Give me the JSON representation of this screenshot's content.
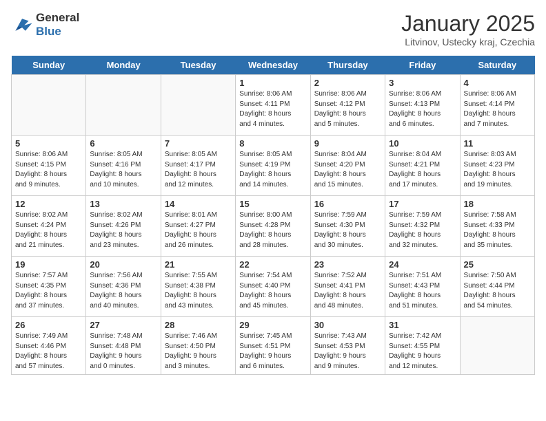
{
  "header": {
    "logo_line1": "General",
    "logo_line2": "Blue",
    "title": "January 2025",
    "subtitle": "Litvinov, Ustecky kraj, Czechia"
  },
  "weekdays": [
    "Sunday",
    "Monday",
    "Tuesday",
    "Wednesday",
    "Thursday",
    "Friday",
    "Saturday"
  ],
  "weeks": [
    [
      {
        "num": "",
        "info": ""
      },
      {
        "num": "",
        "info": ""
      },
      {
        "num": "",
        "info": ""
      },
      {
        "num": "1",
        "info": "Sunrise: 8:06 AM\nSunset: 4:11 PM\nDaylight: 8 hours\nand 4 minutes."
      },
      {
        "num": "2",
        "info": "Sunrise: 8:06 AM\nSunset: 4:12 PM\nDaylight: 8 hours\nand 5 minutes."
      },
      {
        "num": "3",
        "info": "Sunrise: 8:06 AM\nSunset: 4:13 PM\nDaylight: 8 hours\nand 6 minutes."
      },
      {
        "num": "4",
        "info": "Sunrise: 8:06 AM\nSunset: 4:14 PM\nDaylight: 8 hours\nand 7 minutes."
      }
    ],
    [
      {
        "num": "5",
        "info": "Sunrise: 8:06 AM\nSunset: 4:15 PM\nDaylight: 8 hours\nand 9 minutes."
      },
      {
        "num": "6",
        "info": "Sunrise: 8:05 AM\nSunset: 4:16 PM\nDaylight: 8 hours\nand 10 minutes."
      },
      {
        "num": "7",
        "info": "Sunrise: 8:05 AM\nSunset: 4:17 PM\nDaylight: 8 hours\nand 12 minutes."
      },
      {
        "num": "8",
        "info": "Sunrise: 8:05 AM\nSunset: 4:19 PM\nDaylight: 8 hours\nand 14 minutes."
      },
      {
        "num": "9",
        "info": "Sunrise: 8:04 AM\nSunset: 4:20 PM\nDaylight: 8 hours\nand 15 minutes."
      },
      {
        "num": "10",
        "info": "Sunrise: 8:04 AM\nSunset: 4:21 PM\nDaylight: 8 hours\nand 17 minutes."
      },
      {
        "num": "11",
        "info": "Sunrise: 8:03 AM\nSunset: 4:23 PM\nDaylight: 8 hours\nand 19 minutes."
      }
    ],
    [
      {
        "num": "12",
        "info": "Sunrise: 8:02 AM\nSunset: 4:24 PM\nDaylight: 8 hours\nand 21 minutes."
      },
      {
        "num": "13",
        "info": "Sunrise: 8:02 AM\nSunset: 4:26 PM\nDaylight: 8 hours\nand 23 minutes."
      },
      {
        "num": "14",
        "info": "Sunrise: 8:01 AM\nSunset: 4:27 PM\nDaylight: 8 hours\nand 26 minutes."
      },
      {
        "num": "15",
        "info": "Sunrise: 8:00 AM\nSunset: 4:28 PM\nDaylight: 8 hours\nand 28 minutes."
      },
      {
        "num": "16",
        "info": "Sunrise: 7:59 AM\nSunset: 4:30 PM\nDaylight: 8 hours\nand 30 minutes."
      },
      {
        "num": "17",
        "info": "Sunrise: 7:59 AM\nSunset: 4:32 PM\nDaylight: 8 hours\nand 32 minutes."
      },
      {
        "num": "18",
        "info": "Sunrise: 7:58 AM\nSunset: 4:33 PM\nDaylight: 8 hours\nand 35 minutes."
      }
    ],
    [
      {
        "num": "19",
        "info": "Sunrise: 7:57 AM\nSunset: 4:35 PM\nDaylight: 8 hours\nand 37 minutes."
      },
      {
        "num": "20",
        "info": "Sunrise: 7:56 AM\nSunset: 4:36 PM\nDaylight: 8 hours\nand 40 minutes."
      },
      {
        "num": "21",
        "info": "Sunrise: 7:55 AM\nSunset: 4:38 PM\nDaylight: 8 hours\nand 43 minutes."
      },
      {
        "num": "22",
        "info": "Sunrise: 7:54 AM\nSunset: 4:40 PM\nDaylight: 8 hours\nand 45 minutes."
      },
      {
        "num": "23",
        "info": "Sunrise: 7:52 AM\nSunset: 4:41 PM\nDaylight: 8 hours\nand 48 minutes."
      },
      {
        "num": "24",
        "info": "Sunrise: 7:51 AM\nSunset: 4:43 PM\nDaylight: 8 hours\nand 51 minutes."
      },
      {
        "num": "25",
        "info": "Sunrise: 7:50 AM\nSunset: 4:44 PM\nDaylight: 8 hours\nand 54 minutes."
      }
    ],
    [
      {
        "num": "26",
        "info": "Sunrise: 7:49 AM\nSunset: 4:46 PM\nDaylight: 8 hours\nand 57 minutes."
      },
      {
        "num": "27",
        "info": "Sunrise: 7:48 AM\nSunset: 4:48 PM\nDaylight: 9 hours\nand 0 minutes."
      },
      {
        "num": "28",
        "info": "Sunrise: 7:46 AM\nSunset: 4:50 PM\nDaylight: 9 hours\nand 3 minutes."
      },
      {
        "num": "29",
        "info": "Sunrise: 7:45 AM\nSunset: 4:51 PM\nDaylight: 9 hours\nand 6 minutes."
      },
      {
        "num": "30",
        "info": "Sunrise: 7:43 AM\nSunset: 4:53 PM\nDaylight: 9 hours\nand 9 minutes."
      },
      {
        "num": "31",
        "info": "Sunrise: 7:42 AM\nSunset: 4:55 PM\nDaylight: 9 hours\nand 12 minutes."
      },
      {
        "num": "",
        "info": ""
      }
    ]
  ]
}
